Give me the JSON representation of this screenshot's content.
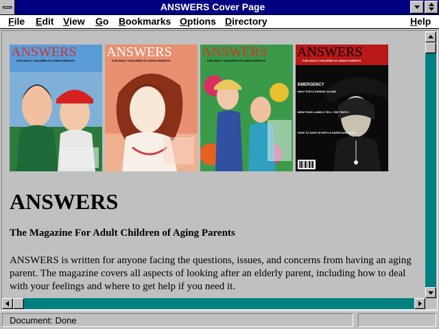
{
  "window": {
    "title": "ANSWERS Cover Page"
  },
  "menu": {
    "file": "File",
    "edit": "Edit",
    "view": "View",
    "go": "Go",
    "bookmarks": "Bookmarks",
    "options": "Options",
    "directory": "Directory",
    "help": "Help"
  },
  "covers": {
    "masthead": "ANSWERS",
    "tagline": "FOR ADULT CHILDREN OF AGING PARENTS",
    "issue4_headlines": [
      "EMERGENCY",
      "HELP FOR A PARENT ALONE",
      "NEW FOOD LABELS TELL THE TRUTH",
      "HOW TO SAVE 55 WITH A HARDCASE HEAD"
    ]
  },
  "page": {
    "heading": "ANSWERS",
    "subheading": "The Magazine For Adult Children of Aging Parents",
    "paragraph": "ANSWERS is written for anyone facing the questions, issues, and concerns from having an aging parent. The magazine covers all aspects of looking after an elderly parent, including how to deal with your feelings and where to get help if you need it."
  },
  "status": {
    "text": "Document: Done"
  },
  "colors": {
    "titlebar": "#000080",
    "scrollbar": "#008080",
    "masthead_red": "#d8302a",
    "masthead_white": "#ffffff"
  }
}
